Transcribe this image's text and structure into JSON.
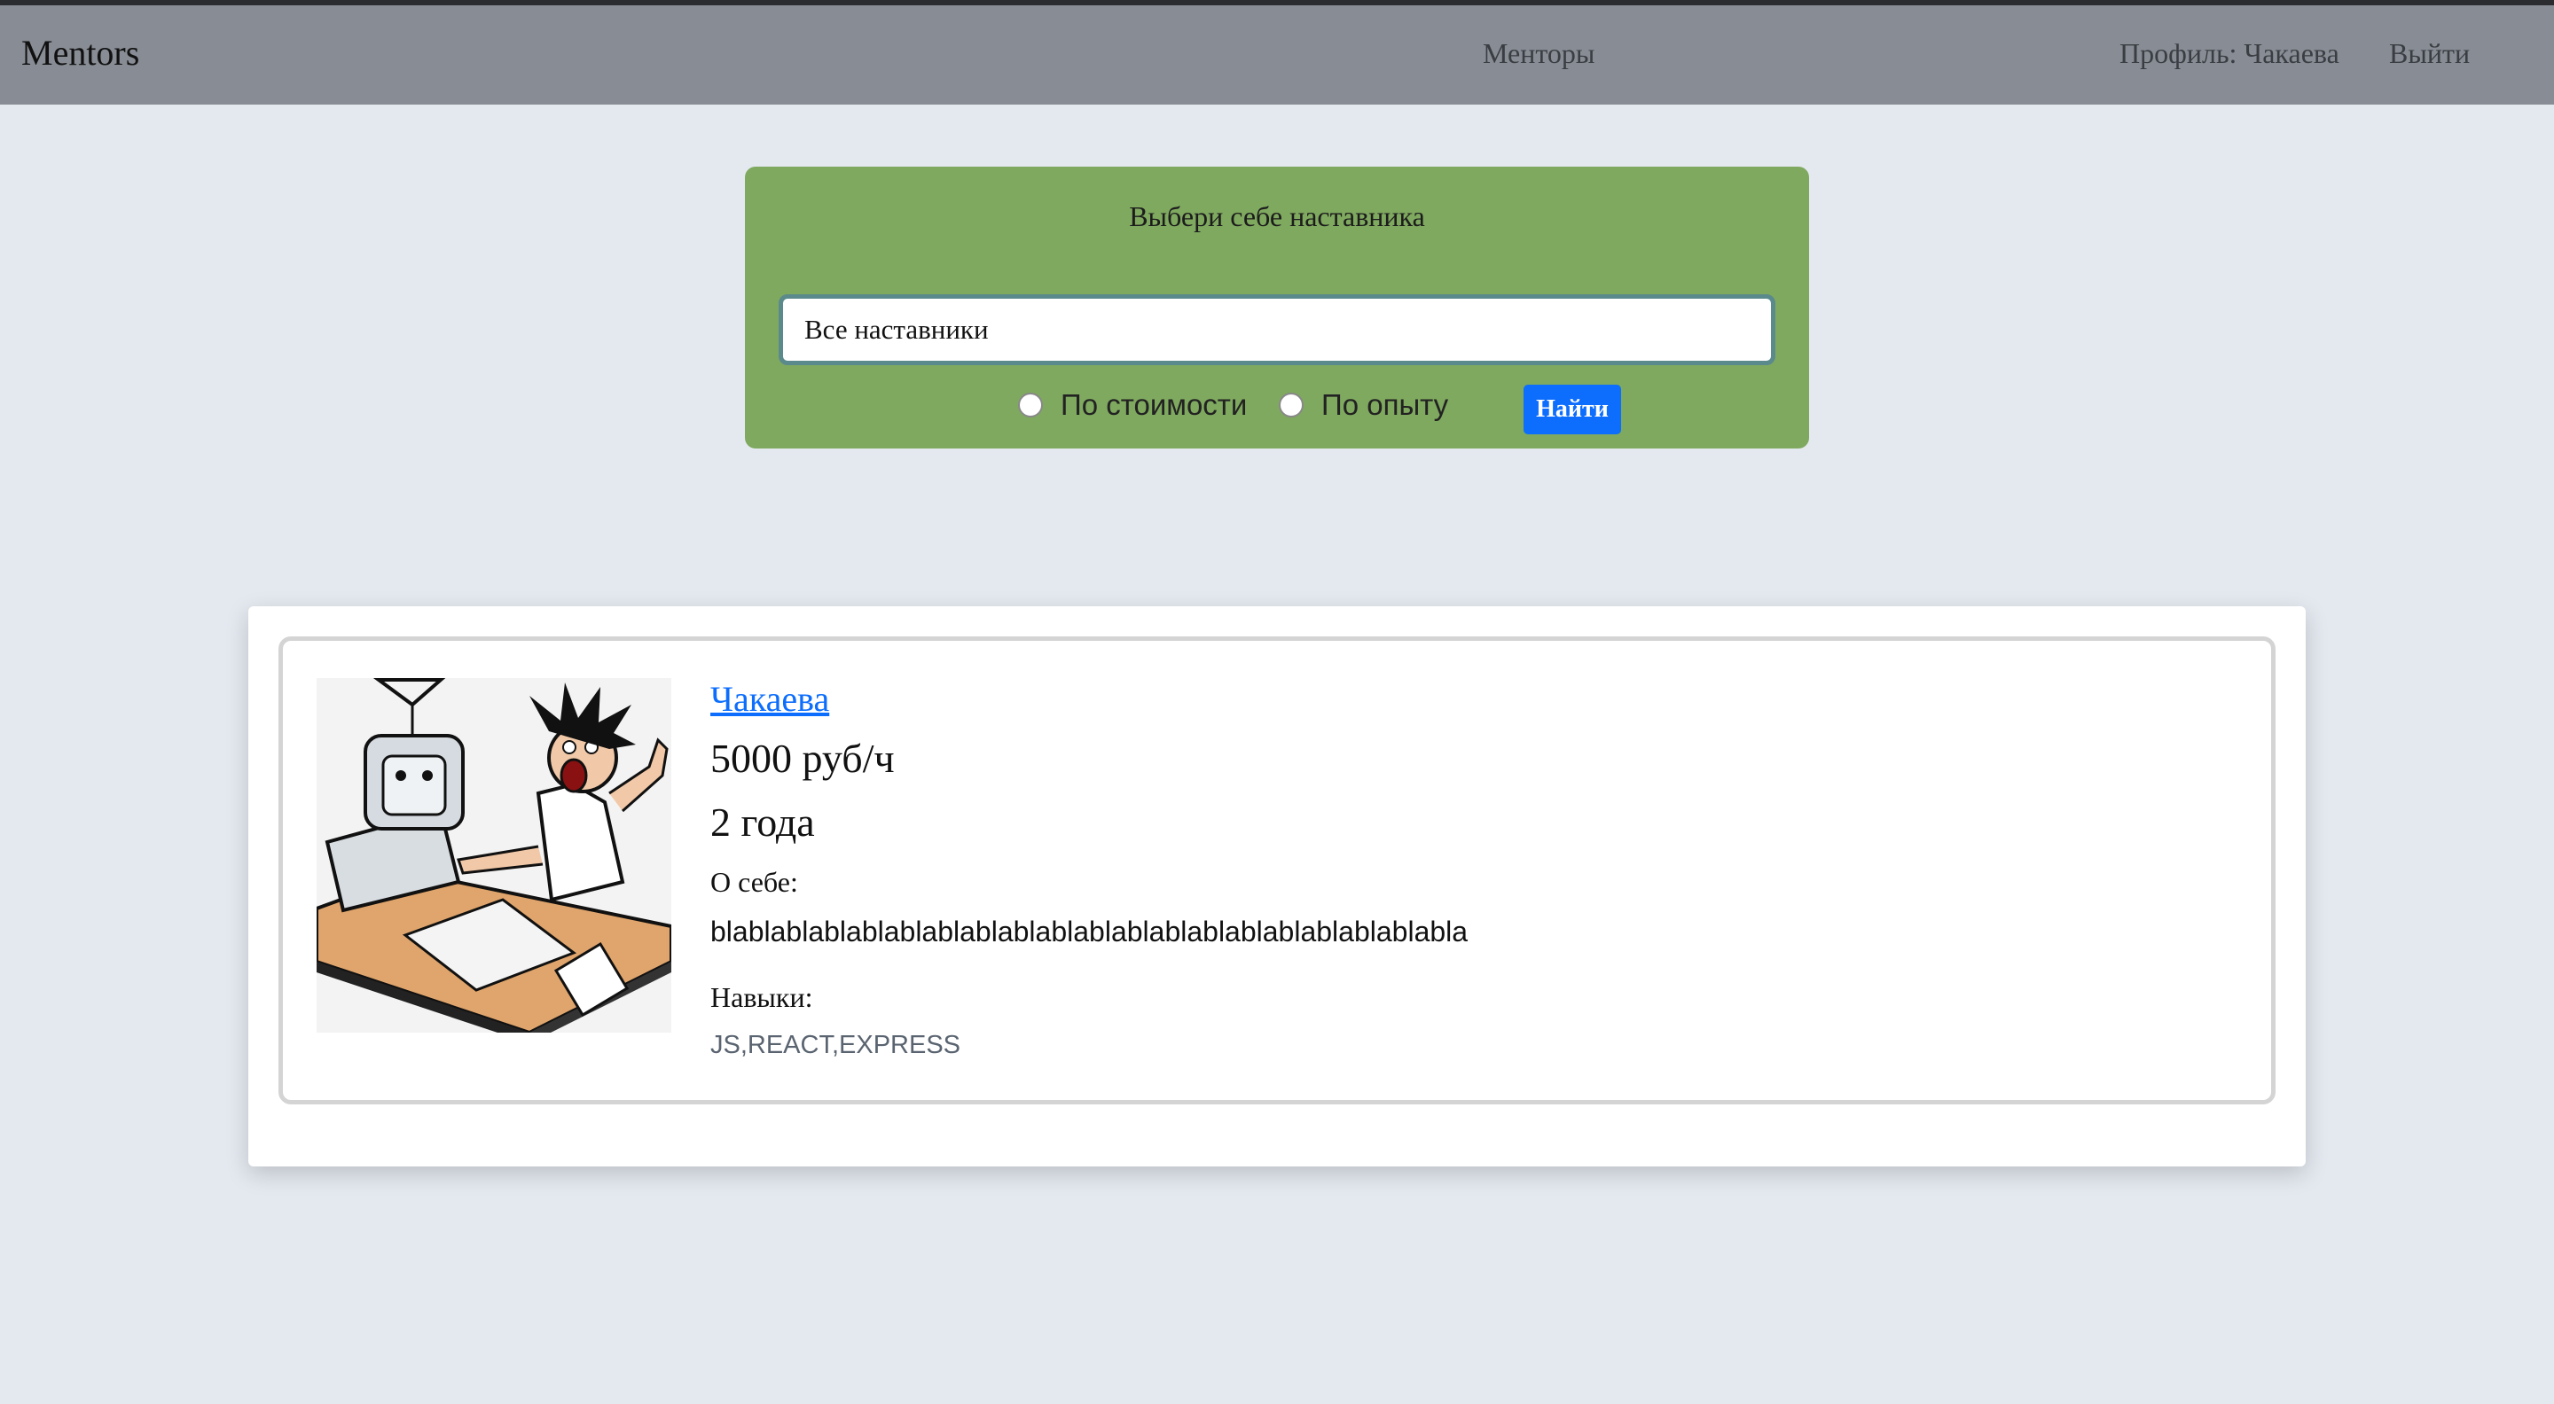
{
  "navbar": {
    "brand": "Mentors",
    "mentors_link": "Менторы",
    "profile_link": "Профиль: Чакаева",
    "logout_link": "Выйти"
  },
  "search": {
    "title": "Выбери себе наставника",
    "input_value": "Все наставники",
    "radio_price_label": "По стоимости",
    "radio_experience_label": "По опыту",
    "find_button_label": "Найти"
  },
  "mentor": {
    "name": "Чакаева",
    "price": "5000 руб/ч",
    "experience": "2 года",
    "about_label": "О себе:",
    "about_text": "blablablablablablablablablablablablablablablablablablablabla",
    "skills_label": "Навыки:",
    "skills": "JS,REACT,EXPRESS",
    "photo_icon": "programmer-cartoon-icon"
  },
  "colors": {
    "navbar": "#888d95",
    "search_panel": "#7fa95f",
    "button": "#0d6efd",
    "page_background": "#e4e9f0"
  }
}
